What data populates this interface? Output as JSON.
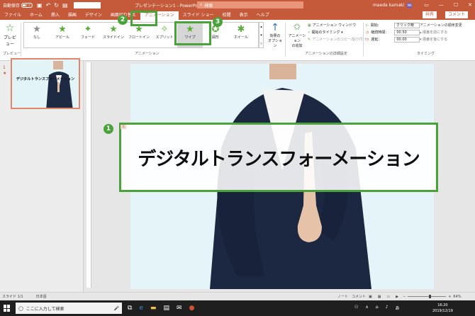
{
  "titlebar": {
    "autosave_label": "自動保存",
    "autosave_state": "オフ",
    "doc_title": "プレゼンテーション1 - PowerPo...",
    "search_placeholder": "検索",
    "user_name": "maeda kamaki",
    "user_initials": "MK"
  },
  "tabs": [
    {
      "label": "ファイル"
    },
    {
      "label": "ホーム"
    },
    {
      "label": "挿入"
    },
    {
      "label": "描画"
    },
    {
      "label": "デザイン"
    },
    {
      "label": "画面切り替え"
    },
    {
      "label": "アニメーション",
      "active": true
    },
    {
      "label": "スライド ショー"
    },
    {
      "label": "校閲"
    },
    {
      "label": "表示"
    },
    {
      "label": "ヘルプ"
    }
  ],
  "share_label": "共有",
  "comment_label": "コメント",
  "ribbon": {
    "preview_label": "プレビュー",
    "preview_group": "プレビュー",
    "animation_group": "アニメーション",
    "animations": [
      {
        "label": "なし",
        "color": "gray"
      },
      {
        "label": "アピール",
        "color": "green"
      },
      {
        "label": "フェード",
        "color": "green"
      },
      {
        "label": "スライドイン",
        "color": "green"
      },
      {
        "label": "フロートイン",
        "color": "green"
      },
      {
        "label": "スプリット",
        "color": "green"
      },
      {
        "label": "ワイプ",
        "color": "green",
        "selected": true
      },
      {
        "label": "図形",
        "color": "green"
      },
      {
        "label": "ホイール",
        "color": "green"
      }
    ],
    "effect_options_label": "効果の\nオプション",
    "add_animation_label": "アニメーション\nの追加",
    "advanced_items": [
      "アニメーション ウィンドウ",
      "開始のタイミング",
      "アニメーションのコピー/貼り付け"
    ],
    "advanced_group": "アニメーションの詳細設定",
    "timing": {
      "start_label": "開始:",
      "start_value": "クリック時",
      "duration_label": "継続時間:",
      "duration_value": "00.50",
      "delay_label": "遅延:",
      "delay_value": "00.00"
    },
    "timing_group": "タイミング",
    "reorder_title": "アニメーションの順序変更",
    "reorder_up": "順番を前にする",
    "reorder_down": "順番を後にする"
  },
  "thumbnail": {
    "number": "1",
    "star": "★",
    "title": "デジタルトランスフォーメーション"
  },
  "slide": {
    "title": "デジタルトランスフォーメーション",
    "anim_tag": "1"
  },
  "callouts": {
    "one": "1",
    "two": "2",
    "three": "3"
  },
  "status": {
    "slide_info": "スライド 1/1",
    "language": "日本語",
    "notes": "ノート",
    "comments": "コメント",
    "zoom": "64%"
  },
  "taskbar": {
    "search_placeholder": "ここに入力して検索",
    "time": "16:20",
    "date": "2019/12/19",
    "ime": "あ"
  },
  "colors": {
    "accent": "#c55a3b",
    "callout_green": "#4aa33a",
    "star_green": "#5aad3b"
  }
}
